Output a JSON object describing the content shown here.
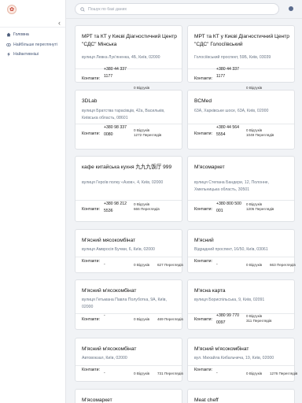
{
  "app": {
    "logo_glyph": "✿"
  },
  "sidebar": {
    "collapse_glyph": "‹",
    "items": [
      {
        "label": "Головна",
        "icon": "home-icon"
      },
      {
        "label": "Найбільше переглянуті",
        "icon": "eye-icon"
      },
      {
        "label": "Найактивніші",
        "icon": "bolt-icon"
      }
    ]
  },
  "search": {
    "placeholder": "Пошук по базі даних",
    "value": ""
  },
  "cards": [
    {
      "title": "МРТ та КТ у Києві Діагностичний Центр \"СДС\" Мінська",
      "address": "вулиця Левка Лук'яненка, 4Б, Київ, 02000",
      "contacts_label": "Контакти:",
      "phone": "+380 44 337 1177",
      "reviews": "0 Відгуків",
      "views": "709 Переглядів"
    },
    {
      "title": "МРТ та КТ у Києві Діагностичний Центр \"СДС\" Голосіївський",
      "address": "Голосіївський проспект, 59Б, Київ, 03039",
      "contacts_label": "Контакти:",
      "phone": "+380 44 337 1177",
      "reviews": "0 Відгуків",
      "views": "660 Переглядів"
    },
    {
      "title": "3DLab",
      "address": "вулиця Братства тарасівців, 42а, Васильків, Київська область, 08601",
      "contacts_label": "Контакти:",
      "phone": "+380 98 337 0080",
      "reviews": "0 Відгуків",
      "views": "1272 Переглядів"
    },
    {
      "title": "BCMed",
      "address": "63А, Харківське шосе, 63А, Київ, 02000",
      "contacts_label": "Контакти:",
      "phone": "+380 44 564 5554",
      "reviews": "0 Відгуків",
      "views": "1049 Переглядів"
    },
    {
      "title": "кафе китайська кухня 九九九饭厅 999",
      "address": "вулиця Героїв полку «Азов», 4, Київ, 02000",
      "contacts_label": "Контакти:",
      "phone": "+380 98 212 5536",
      "reviews": "0 Відгуків",
      "views": "666 Переглядів"
    },
    {
      "title": "М'ясомаркет",
      "address": "вулиця Степана Бандери, 12, Полонне, Хмельницька область, 30501",
      "contacts_label": "Контакти:",
      "phone": "+380 800 500 001",
      "reviews": "0 Відгуків",
      "views": "1205 Переглядів"
    },
    {
      "title": "М'ясний мясокомбінат",
      "address": "вулиця Амвросія Бучми, 6, Київ, 02000",
      "contacts_label": "Контакти:",
      "phone": "-",
      "reviews": "0 Відгуків",
      "views": "627 Переглядів"
    },
    {
      "title": "М'ясний",
      "address": "Відрадний проспект, 16/50, Київ, 03061",
      "contacts_label": "Контакти:",
      "phone": "-",
      "reviews": "0 Відгуків",
      "views": "663 Переглядів"
    },
    {
      "title": "М'ясний м'ясокомбінат",
      "address": "вулиця Гетьмана Павла Полуботка, 9А, Київ, 02000",
      "contacts_label": "Контакти:",
      "phone": "-",
      "reviews": "0 Відгуків",
      "views": "469 Переглядів"
    },
    {
      "title": "М'ясна карта",
      "address": "вулиця Бориспільська, 9, Київ, 02091",
      "contacts_label": "Контакти:",
      "phone": "+380 99 770 0097",
      "reviews": "0 Відгуків",
      "views": "311 Переглядів"
    },
    {
      "title": "М'ясний м'ясокомбінат",
      "address": "Автовокзал, Київ, 02000",
      "contacts_label": "Контакти:",
      "phone": "-",
      "reviews": "0 Відгуків",
      "views": "731 Переглядів"
    },
    {
      "title": "М'ясний м'ясокомбінат",
      "address": "вул. Михайла Кибальчича, 19, Київ, 02000",
      "contacts_label": "Контакти:",
      "phone": "-",
      "reviews": "0 Відгуків",
      "views": "1276 Переглядів"
    },
    {
      "title": "М'ясомаркет",
      "address": "",
      "contacts_label": "",
      "phone": "",
      "reviews": "",
      "views": ""
    },
    {
      "title": "Meat cheff",
      "address": "",
      "contacts_label": "",
      "phone": "",
      "reviews": "",
      "views": ""
    }
  ]
}
